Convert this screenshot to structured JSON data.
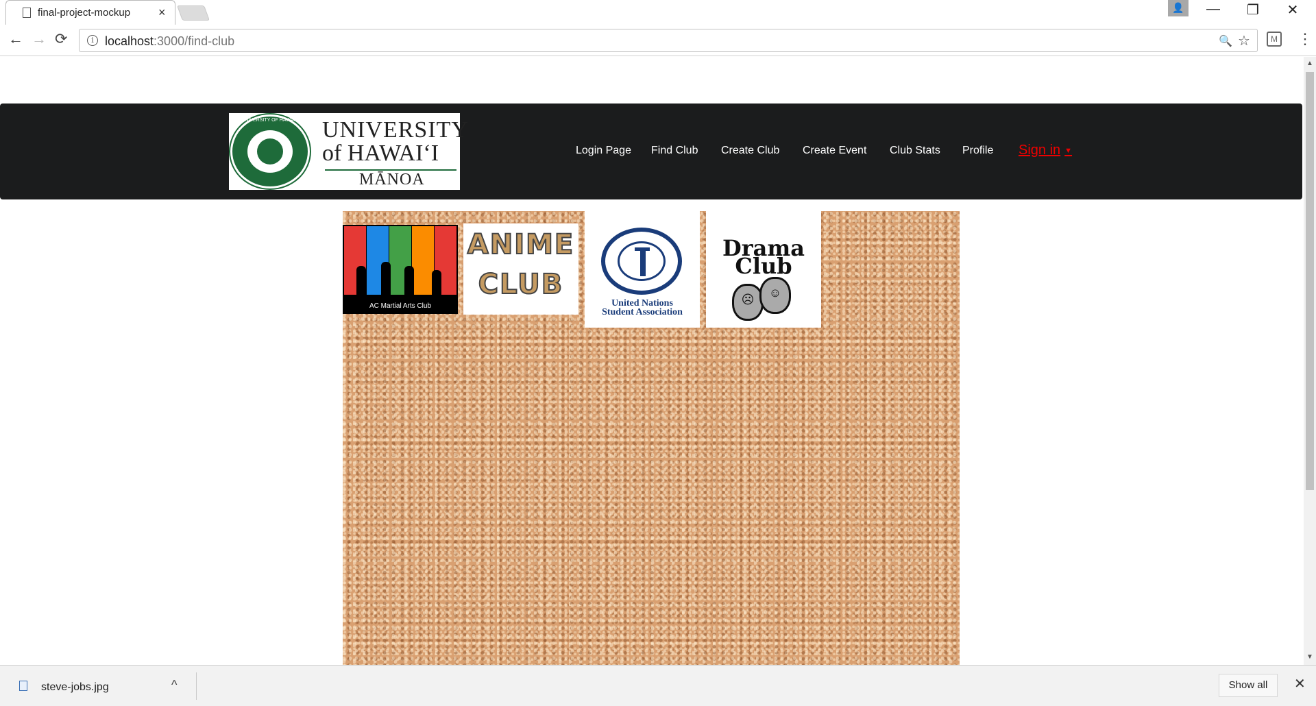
{
  "browser": {
    "tab_title": "final-project-mockup",
    "tab_close": "×",
    "url_host": "localhost",
    "url_path": ":3000/find-club",
    "back_icon": "←",
    "forward_icon": "→",
    "reload_icon": "⟳",
    "zoom_icon": "🔍",
    "star_icon": "☆",
    "menu_icon": "⋮",
    "minimize": "—",
    "restore": "❐",
    "close": "✕"
  },
  "navbar": {
    "logo": {
      "line1": "UNIVERSITY",
      "line2": "of HAWAI‘I",
      "line3": "MĀNOA",
      "seal_text": "UNIVERSITY OF HAWAI‘I"
    },
    "items": [
      {
        "label": "Login Page"
      },
      {
        "label": "Find Club"
      },
      {
        "label": "Create Club"
      },
      {
        "label": "Create Event"
      },
      {
        "label": "Club Stats"
      },
      {
        "label": "Profile"
      }
    ],
    "signin": {
      "label": "Sign in",
      "caret": "▼",
      "color": "#ee0000"
    }
  },
  "clubs": [
    {
      "name": "AC Martial Arts Club"
    },
    {
      "name": "ANIME CLUB",
      "line1": "ANIME",
      "line2": "CLUB"
    },
    {
      "name": "United Nations Student Association",
      "line1": "United Nations",
      "line2": "Student Association"
    },
    {
      "name": "Drama Club",
      "line1": "Drama",
      "line2": "Club"
    }
  ],
  "downloads": {
    "file": "steve-jobs.jpg",
    "caret": "^",
    "show_all": "Show all",
    "close": "✕"
  },
  "colors": {
    "navbar_bg": "#1b1c1d",
    "uh_green": "#1e6b3a",
    "un_blue": "#1a3c7a",
    "cork": "#d9a071"
  }
}
